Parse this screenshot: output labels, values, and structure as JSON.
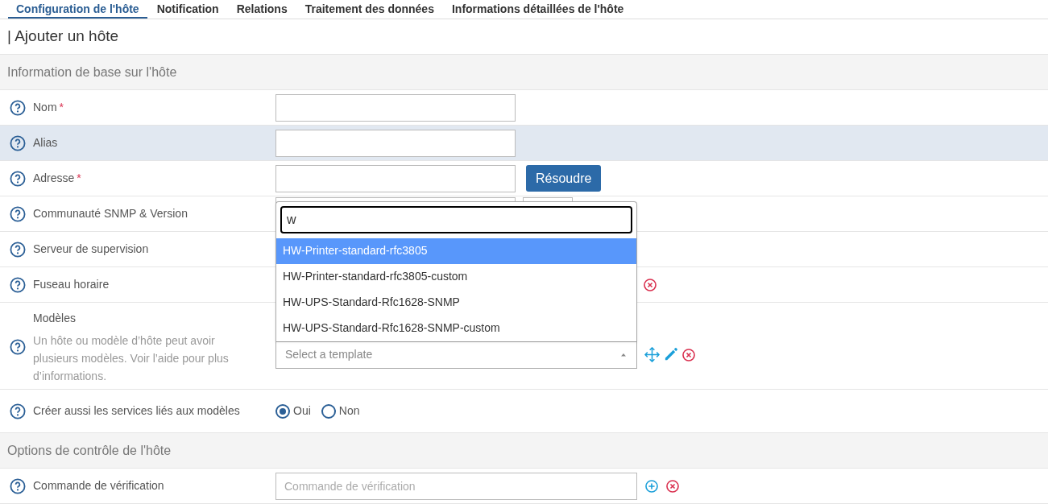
{
  "tabs": [
    {
      "label": "Configuration de l'hôte",
      "selected": true
    },
    {
      "label": "Notification",
      "selected": false
    },
    {
      "label": "Relations",
      "selected": false
    },
    {
      "label": "Traitement des données",
      "selected": false
    },
    {
      "label": "Informations détaillées de l'hôte",
      "selected": false
    }
  ],
  "title": "| Ajouter un hôte",
  "rows": [
    {
      "kind": "section",
      "title": "Information de base sur l'hôte"
    },
    {
      "kind": "text",
      "label": "Nom",
      "required_mark": "*",
      "highlighted": false
    },
    {
      "kind": "text",
      "label": "Alias",
      "highlighted": true
    },
    {
      "kind": "text_button",
      "label": "Adresse",
      "required_mark": "*",
      "highlighted": false,
      "button": "Résoudre"
    },
    {
      "kind": "pair",
      "label": "Communauté SNMP & Version",
      "highlighted": false
    },
    {
      "kind": "select",
      "label": "Serveur de supervision",
      "highlighted": false
    },
    {
      "kind": "select",
      "label": "Fuseau horaire",
      "highlighted": false,
      "clear": true
    },
    {
      "kind": "templates",
      "label": "Modèles",
      "description": "Un hôte ou modèle d’hôte peut avoir plusieurs modèles. Voir l’aide pour plus d’informations.",
      "placeholder": "Select a template",
      "dropdown": {
        "search": "w",
        "options": [
          {
            "label": "HW-Printer-standard-rfc3805",
            "selected": true
          },
          {
            "label": "HW-Printer-standard-rfc3805-custom",
            "selected": false
          },
          {
            "label": "HW-UPS-Standard-Rfc1628-SNMP",
            "selected": false
          },
          {
            "label": "HW-UPS-Standard-Rfc1628-SNMP-custom",
            "selected": false
          }
        ]
      }
    },
    {
      "kind": "radio",
      "label": "Créer aussi les services liés aux modèles",
      "options": [
        {
          "label": "Oui",
          "selected": true
        },
        {
          "label": "Non",
          "selected": false
        }
      ]
    },
    {
      "kind": "section",
      "title": "Options de contrôle de l'hôte"
    },
    {
      "kind": "command",
      "label": "Commande de vérification",
      "placeholder": "Commande de vérification"
    }
  ]
}
